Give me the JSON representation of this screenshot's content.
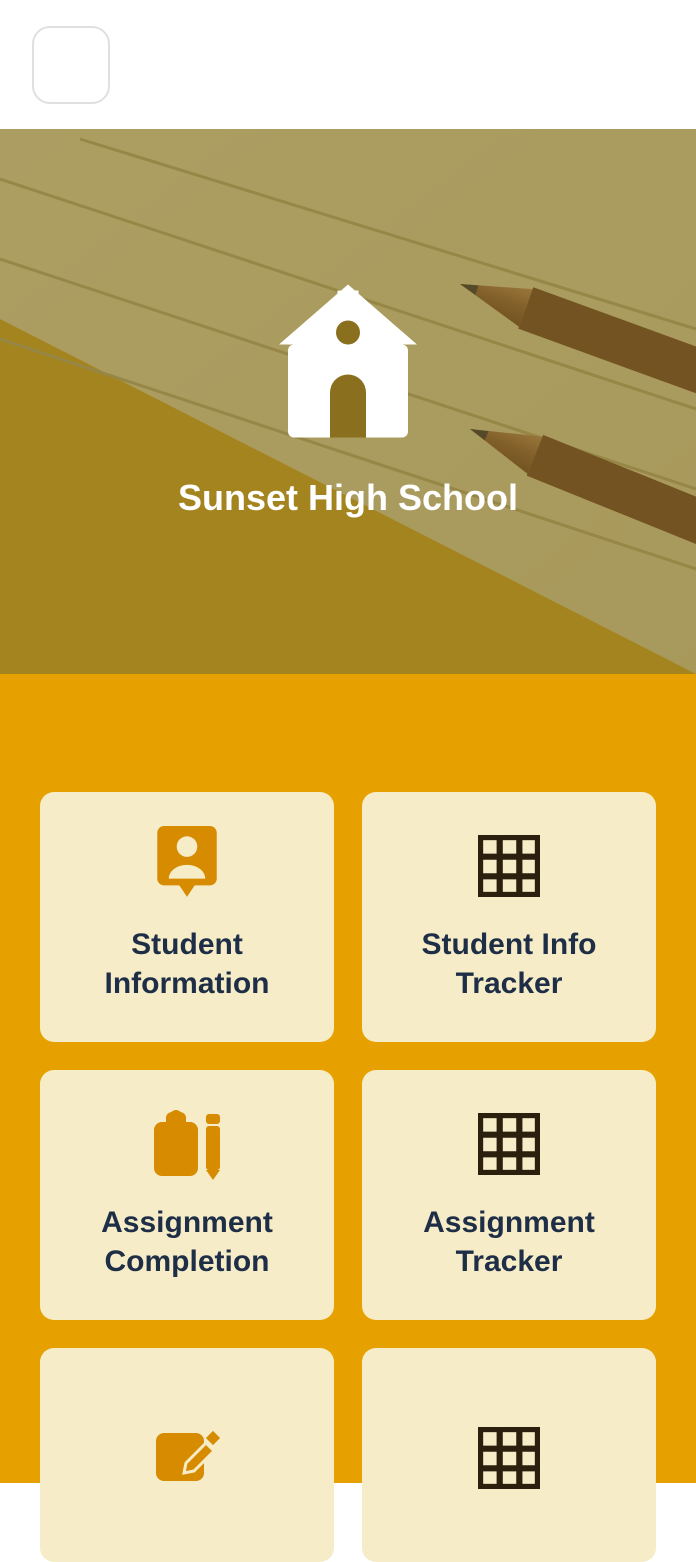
{
  "header": {
    "school_name": "Sunset High School"
  },
  "cards": [
    {
      "label": "Student Information",
      "icon": "person-pin-icon",
      "icon_color": "#d68b00"
    },
    {
      "label": "Student Info Tracker",
      "icon": "grid-icon",
      "icon_color": "#2b1f0e"
    },
    {
      "label": "Assignment Completion",
      "icon": "clipboard-pencil-icon",
      "icon_color": "#d68b00"
    },
    {
      "label": "Assignment Tracker",
      "icon": "grid-icon",
      "icon_color": "#2b1f0e"
    },
    {
      "label": "",
      "icon": "edit-square-icon",
      "icon_color": "#d68b00"
    },
    {
      "label": "",
      "icon": "grid-icon",
      "icon_color": "#2b1f0e"
    }
  ],
  "colors": {
    "accent_gold": "#e6a100",
    "card_bg": "#f6edc8",
    "text_dark": "#1f2e47",
    "icon_brown": "#2b1f0e",
    "icon_orange": "#d68b00"
  }
}
